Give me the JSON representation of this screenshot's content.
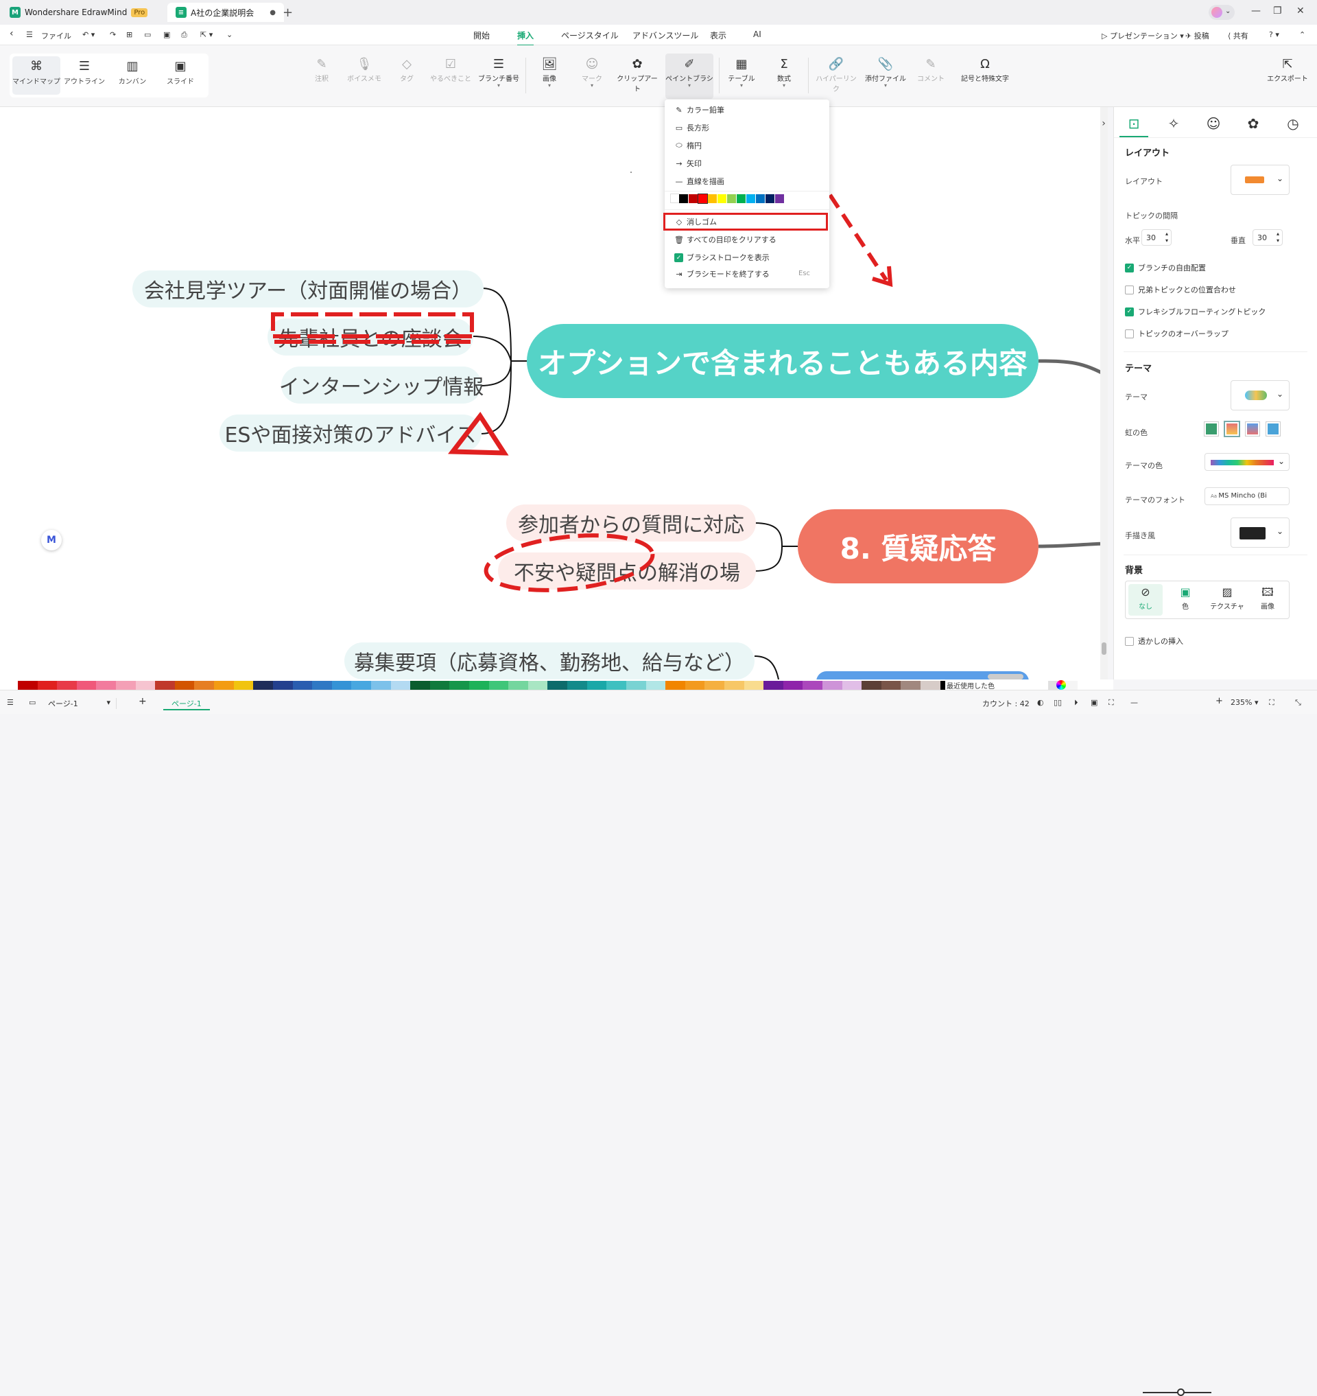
{
  "title_bar": {
    "app_name": "Wondershare EdrawMind",
    "pro_badge": "Pro",
    "doc_tab": "A社の企業説明会",
    "tab_modified_dot": "●",
    "new_tab": "+",
    "window_minimize": "—",
    "window_restore": "❐",
    "window_close": "✕"
  },
  "menu": {
    "back": "‹",
    "file": "ファイル",
    "tabs": [
      "開始",
      "挿入",
      "ページスタイル",
      "アドバンスツール",
      "表示",
      "AI"
    ],
    "active_tab": "挿入",
    "presentation": "プレゼンテーション",
    "post": "投稿",
    "share": "共有",
    "help": "?"
  },
  "view_modes": [
    "マインドマップ",
    "アウトライン",
    "カンバン",
    "スライド"
  ],
  "toolbar": {
    "items": [
      {
        "label": "注釈",
        "icon": "✎",
        "disabled": true
      },
      {
        "label": "ボイスメモ",
        "icon": "🎙",
        "disabled": true
      },
      {
        "label": "タグ",
        "icon": "◇",
        "disabled": true
      },
      {
        "label": "やるべきこと",
        "icon": "☑",
        "disabled": true
      },
      {
        "label": "ブランチ番号",
        "icon": "☰",
        "disabled": false
      },
      {
        "label": "画像",
        "icon": "🖼",
        "disabled": false
      },
      {
        "label": "マーク",
        "icon": "☺",
        "disabled": true
      },
      {
        "label": "クリップアート",
        "icon": "✿",
        "disabled": false
      },
      {
        "label": "ペイントブラシ",
        "icon": "✐",
        "disabled": false
      },
      {
        "label": "テーブル",
        "icon": "▦",
        "disabled": false
      },
      {
        "label": "数式",
        "icon": "Σ",
        "disabled": false
      },
      {
        "label": "ハイパーリンク",
        "icon": "🔗",
        "disabled": true
      },
      {
        "label": "添付ファイル",
        "icon": "📎",
        "disabled": false
      },
      {
        "label": "コメント",
        "icon": "✎",
        "disabled": true
      },
      {
        "label": "記号と特殊文字",
        "icon": "Ω",
        "disabled": false
      }
    ],
    "export": "エクスポート"
  },
  "dropdown": {
    "items": [
      "カラー鉛筆",
      "長方形",
      "楕円",
      "矢印",
      "直線を描画"
    ],
    "colors": [
      "#000000",
      "#c00000",
      "#ff0000",
      "#ffc000",
      "#ffff00",
      "#92d050",
      "#00b050",
      "#00b0f0",
      "#0070c0",
      "#002060",
      "#7030a0"
    ],
    "eraser": "消しゴム",
    "clear_all": "すべての目印をクリアする",
    "show_strokes": "ブラシストロークを表示",
    "exit_mode": "ブラシモードを終了する",
    "exit_shortcut": "Esc"
  },
  "mindmap": {
    "topic_options": "オプションで含まれることもある内容",
    "options_subs": [
      "会社見学ツアー（対面開催の場合）",
      "先輩社員との座談会",
      "インターンシップ情報",
      "ESや面接対策のアドバイス"
    ],
    "topic_qa": "8. 質疑応答",
    "qa_subs": [
      "参加者からの質問に対応",
      "不安や疑問点の解消の場"
    ],
    "next_sub": "募集要項（応募資格、勤務地、給与など）"
  },
  "right_panel": {
    "layout_header": "レイアウト",
    "layout_label": "レイアウト",
    "spacing_label": "トピックの間隔",
    "horizontal": "水平",
    "horizontal_value": "30",
    "vertical": "垂直",
    "vertical_value": "30",
    "checkboxes": [
      {
        "label": "ブランチの自由配置",
        "checked": true
      },
      {
        "label": "兄弟トピックとの位置合わせ",
        "checked": false
      },
      {
        "label": "フレキシブルフローティングトピック",
        "checked": true
      },
      {
        "label": "トピックのオーバーラップ",
        "checked": false
      }
    ],
    "theme_header": "テーマ",
    "theme_label": "テーマ",
    "rainbow_label": "虹の色",
    "theme_color_label": "テーマの色",
    "theme_font_label": "テーマのフォント",
    "theme_font_value": "MS Mincho (Bi",
    "handdrawn_label": "手描き風",
    "background_header": "背景",
    "bg_options": [
      "なし",
      "色",
      "テクスチャ",
      "画像"
    ],
    "watermark": "透かしの挿入"
  },
  "palette": [
    "#c00000",
    "#e0201e",
    "#e83a48",
    "#f0587a",
    "#f27b9d",
    "#f4a0b6",
    "#f6c4d0",
    "#c0392b",
    "#d35400",
    "#e67e22",
    "#f39c12",
    "#f1c40f",
    "#1f2d5a",
    "#24408e",
    "#2a5db0",
    "#2f78c4",
    "#3493d6",
    "#47a7e0",
    "#7cc1ea",
    "#b3daf2",
    "#0b5d2e",
    "#107a3c",
    "#16964a",
    "#1db259",
    "#3fc679",
    "#74d69e",
    "#a9e6c3",
    "#0d6b6b",
    "#138a8a",
    "#1aa8a8",
    "#3fc0c0",
    "#79d3d3",
    "#b1e6e6",
    "#f18500",
    "#f39a1e",
    "#f5b040",
    "#f7c766",
    "#f9dc8e",
    "#6a1b9a",
    "#8e24aa",
    "#ab47bc",
    "#ce93d8",
    "#e1bee7",
    "#5d4037",
    "#795548",
    "#a1887f",
    "#d7ccc8",
    "#000000",
    "#424242",
    "#757575",
    "#9e9e9e",
    "#bdbdbd",
    "#e0e0e0",
    "#f5f5f5"
  ],
  "palette_recent_label": "最近使用した色",
  "status": {
    "page_select": "ページ-1",
    "page_tab": "ページ-1",
    "count": "カウント : 42",
    "zoom": "235%",
    "add": "+"
  }
}
